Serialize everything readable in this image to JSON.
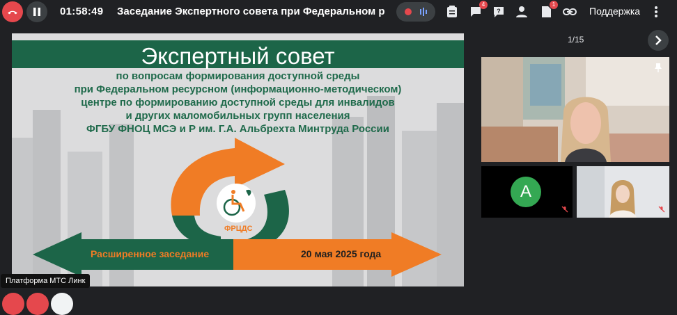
{
  "toolbar": {
    "timer": "01:58:49",
    "title": "Заседание Экспертного совета при Федеральном р",
    "chat_badge": "4",
    "docs_badge": "1",
    "support_label": "Поддержка"
  },
  "slide": {
    "header": "Экспертный совет",
    "lines": [
      "по вопросам формирования доступной среды",
      "при Федеральном ресурсном (информационно-методическом)",
      "центре по формированию доступной среды для инвалидов",
      "и других маломобильных групп населения",
      "ФГБУ ФНОЦ МСЭ и Р им. Г.А. Альбрехта Минтруда России"
    ],
    "left_arrow_label": "Расширенное заседание",
    "right_arrow_label": "20 мая 2025 года",
    "logo_text": "ФРЦДС"
  },
  "viewer": {
    "page_indicator": "1/15"
  },
  "participants": {
    "avatar_letter": "А"
  },
  "status": {
    "platform_label": "Платформа МТС Линк"
  },
  "colors": {
    "brand_green": "#1c6548",
    "brand_orange": "#f07c25",
    "hangup_red": "#e5484d",
    "avatar_green": "#34a853"
  }
}
